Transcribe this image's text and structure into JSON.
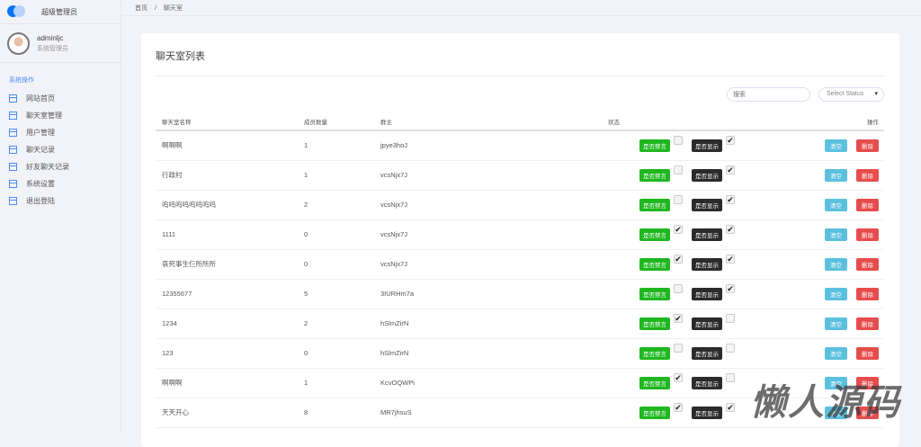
{
  "app": {
    "title": "超级管理员"
  },
  "user": {
    "name": "adminljc",
    "role": "系统管理员"
  },
  "sidebar": {
    "section": "系统操作",
    "items": [
      "网站首页",
      "聊天室管理",
      "用户管理",
      "聊天记录",
      "好友聊天记录",
      "系统设置",
      "退出登陆"
    ]
  },
  "breadcrumb": {
    "home": "首页",
    "sep": "/",
    "current": "聊天室"
  },
  "page": {
    "title": "聊天室列表",
    "search_placeholder": "搜索",
    "select_status": "Select Status"
  },
  "table": {
    "headers": [
      "聊天室名称",
      "成员数量",
      "群主",
      "状态",
      "操作"
    ],
    "mute_label": "是否禁言",
    "show_label": "是否显示",
    "clear_label": "清空",
    "delete_label": "删除",
    "rows": [
      {
        "name": "啊啊啊",
        "members": "1",
        "owner": "jpye3hoJ",
        "muted": false,
        "shown": true
      },
      {
        "name": "行政村",
        "members": "1",
        "owner": "vcsNjx7J",
        "muted": false,
        "shown": true
      },
      {
        "name": "呜呜呜呜呜呜呜呜",
        "members": "2",
        "owner": "vcsNjx7J",
        "muted": false,
        "shown": true
      },
      {
        "name": "1111",
        "members": "0",
        "owner": "vcsNjx7J",
        "muted": true,
        "shown": true
      },
      {
        "name": "哀死事生仨所所所",
        "members": "0",
        "owner": "vcsNjx7J",
        "muted": true,
        "shown": true
      },
      {
        "name": "12355677",
        "members": "5",
        "owner": "3IURHm7a",
        "muted": false,
        "shown": true
      },
      {
        "name": "1234",
        "members": "2",
        "owner": "hSlmZirN",
        "muted": true,
        "shown": false
      },
      {
        "name": "123",
        "members": "0",
        "owner": "hSlmZirN",
        "muted": false,
        "shown": false
      },
      {
        "name": "啊啊啊",
        "members": "1",
        "owner": "KcvOQWPi",
        "muted": true,
        "shown": false
      },
      {
        "name": "天天开心",
        "members": "8",
        "owner": "MR7jhsuS",
        "muted": true,
        "shown": true
      }
    ]
  },
  "watermark": "懒人源码"
}
